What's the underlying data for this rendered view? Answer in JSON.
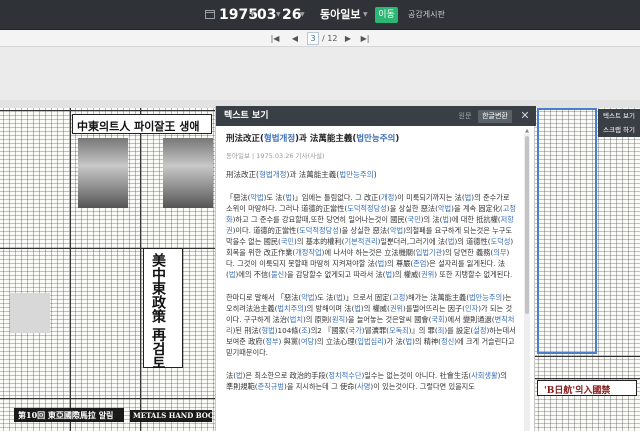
{
  "topbar": {
    "year": "1975",
    "month": "03",
    "day": "26",
    "paper": "동아일보",
    "move_label": "이동",
    "board_link": "공감게시판",
    "calendar_icon": "calendar-icon"
  },
  "nav": {
    "current_page": "3",
    "total_pages": "/ 12",
    "first_icon": "first-page-icon",
    "prev_icon": "prev-page-icon",
    "next_icon": "next-page-icon",
    "last_icon": "last-page-icon"
  },
  "modal": {
    "title": "텍스트 보기",
    "btn_original": "원문",
    "btn_hanja": "한글변환",
    "close_icon": "close-icon",
    "article": {
      "title_pre": "刑法改正(",
      "title_b1": "형법개정",
      "title_mid": ")과 法萬能主義(",
      "title_b2": "법만능주의",
      "title_post": ")",
      "meta": "동아일보 | 1975.03.26 기사(사설)",
      "sub_pre": "刑法改正(",
      "sub_b1": "형법개정",
      "sub_mid": ")과 法萬能主義(",
      "sub_b2": "법만능주의",
      "sub_post": ")",
      "p1": "「惡法(악법)도 法(법)」임에는 틀림없다. 그 改正(개정)이 미룩되기까지는 法(법)의 준수가로 소위이 마땅하다. 그러나 道德的正當性(도덕적정당성)을 상실한 惡法(악법)을 계속 固定化(고정화)하고 그 준수를 강요할때,또한 당연히 일어나는것이 國民(국민)의 法(법)에 대한 抵抗權(저항권)이다. 道德的正當性(도덕적정당성)을 상실한 惡法(악법)의철폐를 요구하게 되는것은 누구도 막을수 없는 國民(국민)의 基本的權利(기본적권리)일뿐더러,그러기에 法(법)의 道德性(도덕성)회복을 위한 改正作業(개정작업)에 나서야 하는것은 立法機關(입법기관)의 당연한 義務(의무)다. 그것이 이룩되지 못할때 마땅히 지켜져야할 法(법)의 尊嚴(존엄)은 설자리를 잃게된다. 法(법)에의 不信(불신)을 감당할수 없게되고 따라서 法(법)의 權威(권위) 또한 지탱할수 없게된다.",
      "p2": "한마디로 말해서 「惡法(악법)도 法(법)」으로서 固定(고정)해가는 法萬能主義(법만능주의)는 오히려法治主義(법치주의)의 방해이며 法(법)의 權威(권위)를떨어뜨리는 因子(인자)가 되는 것이다. 구구하게 法治(법치)의 原則(원칙)을 늘어놓는 것은알씨 國會(국회)에서 變則通過(변칙처리)된 刑法(형법)104條(조)의2 『國家(국가)冒瀆罪(모독죄)』의 罪(죄)를 設定(설정)하는데서 보여준 政府(정부) 與黨(여당)의 立法心理(입법심리)가 法(법)의 精神(정신)에 크게 거슬린다고 믿기때문이다.",
      "p3": "法(법)은 최소한으로 政治的手段(정치적수단)일수는 없는것이 아니다. 社會生活(사회생활)의 準則規範(준칙규범)을 지시하는데 그 使命(사명)이 있는것이다. 그렇다면 있을지도"
    }
  },
  "mini_tools": {
    "text_view": "텍스트 보기",
    "scrap": "스크랩 하기"
  },
  "newspaper": {
    "headline1": "中東의트人 파이잘王 생애",
    "headline2": "美中東政策 再검토",
    "banner_left": "第10回 東亞國際馬拉 알림",
    "banner_left2": "METALS HAND BOOK",
    "right_headline": "'B日航'의入國禁"
  },
  "colors": {
    "topbar_bg": "#2f3338",
    "accent_green": "#2bb673",
    "link_blue": "#3a6fb8",
    "selection_blue": "#4a7fd0"
  }
}
